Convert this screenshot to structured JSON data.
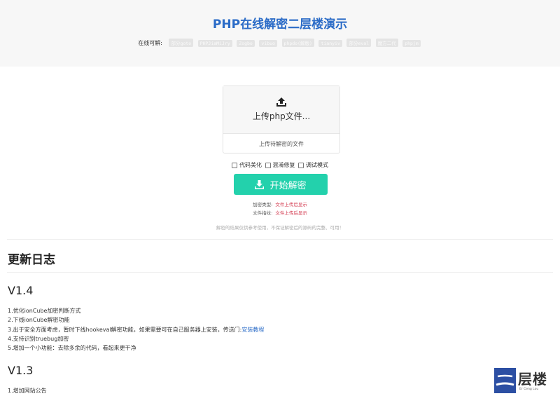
{
  "header": {
    "title": "PHP在线解密二层楼演示",
    "supported_label": "在线可解:",
    "tags": [
      "部分goto",
      "PHPJiaMiJry",
      "Zogbo",
      "vibuo",
      "phpdo(解版)",
      "tianyiv",
      "部分eval",
      "魔方二代",
      "phpjm"
    ]
  },
  "upload": {
    "icon": "upload-icon",
    "title": "上传php文件...",
    "subtitle": "上传待解密的文件"
  },
  "options": [
    {
      "label": "代码美化",
      "checked": false
    },
    {
      "label": "混淆修复",
      "checked": false
    },
    {
      "label": "调试模式",
      "checked": false
    }
  ],
  "start_button": {
    "label": "开始解密",
    "icon": "download-icon"
  },
  "info": {
    "encrypt_type_label": "加密类型:",
    "encrypt_type_value": "文件上传后显示",
    "file_hash_label": "文件指纹:",
    "file_hash_value": "文件上传后显示"
  },
  "disclaimer": "解密的结果仅供参考使用，不保证解密后的源码的完整、可用！",
  "changelog": {
    "title": "更新日志",
    "versions": [
      {
        "version": "V1.4",
        "items": [
          "1.优化ionCube加密判断方式",
          "2.下线ionCube解密功能",
          "3.出于安全方面考虑，暂时下线hookeval解密功能，如果需要可在自己服务器上安装，传送门:",
          "4.支持识别truebug加密",
          "5.增加一个小功能：去除多余的代码，看起来更干净"
        ],
        "link_text": "安装教程"
      },
      {
        "version": "V1.3",
        "items": [
          "1.增加网站公告"
        ]
      }
    ]
  },
  "logo": {
    "text": "层楼",
    "subtitle": "Er Ceng Lou"
  },
  "colors": {
    "accent": "#2a6bc7",
    "button": "#23d1ac",
    "info_value": "#d33a4f",
    "logo_box": "#2c4fa3"
  }
}
